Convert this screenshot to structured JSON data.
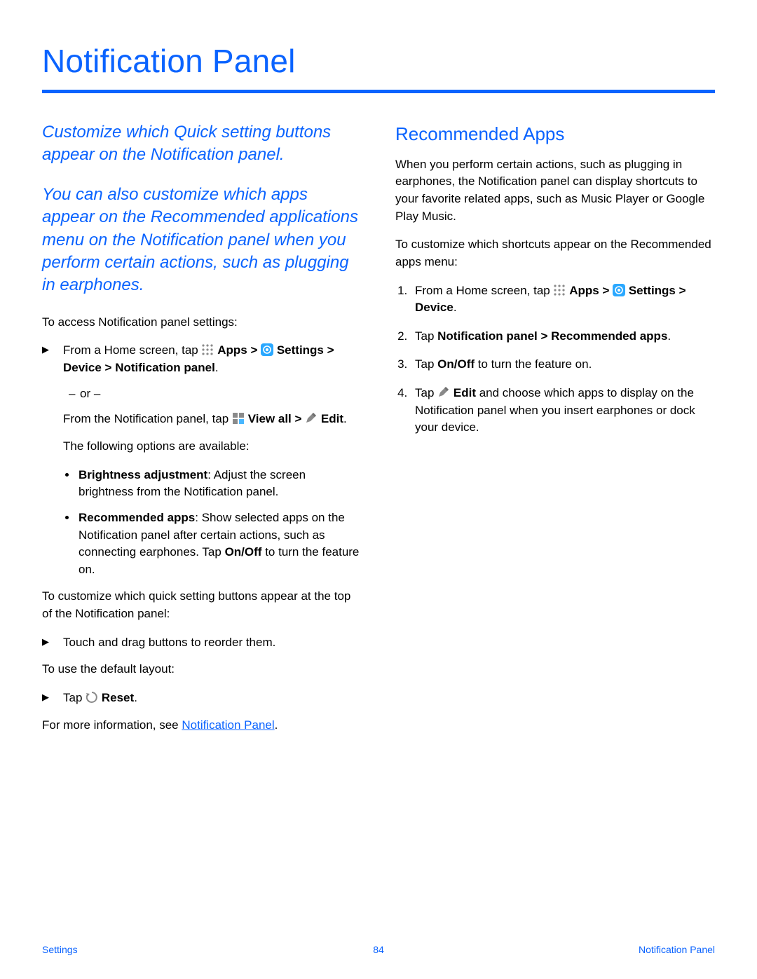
{
  "title": "Notification Panel",
  "left": {
    "intro1": "Customize which Quick setting buttons appear on the Notification panel.",
    "intro2": "You can also customize which apps appear on the Recommended applications menu on the Notification panel when you perform certain actions, such as plugging in earphones.",
    "access_lead": "To access Notification panel settings:",
    "access_step_prefix": "From a Home screen, tap ",
    "apps_label": "Apps",
    "gt1": " > ",
    "settings_label": "Settings",
    "path_tail": " > Device > Notification panel",
    "or_label": "or –",
    "alt_prefix": "From the Notification panel, tap ",
    "viewall_label": "View all",
    "edit_label": "Edit",
    "options_lead": "The following options are available:",
    "opt1_b": "Brightness adjustment",
    "opt1_rest": ": Adjust the screen brightness from the Notification panel.",
    "opt2_b": "Recommended apps",
    "opt2_rest": ": Show selected apps on the Notification panel after certain actions, such as connecting earphones. Tap ",
    "onoff": "On/Off",
    "opt2_tail": " to turn the feature on.",
    "customize_lead": "To customize which quick setting buttons appear at the top of the Notification panel:",
    "reorder": "Touch and drag buttons to reorder them.",
    "default_lead": "To use the default layout:",
    "tap_word": "Tap ",
    "reset_label": "Reset",
    "more_info_prefix": "For more information, see ",
    "more_info_link": "Notification Panel",
    "period": "."
  },
  "right": {
    "heading": "Recommended Apps",
    "p1": "When you perform certain actions, such as plugging in earphones, the Notification panel can display shortcuts to your favorite related apps, such as Music Player or Google Play Music.",
    "p2": "To customize which shortcuts appear on the Recommended apps menu:",
    "s1_prefix": "From a Home screen, tap ",
    "s1_apps": "Apps",
    "s1_gt": " > ",
    "s1_settings": "Settings",
    "s1_tail": " > Device",
    "s2_prefix": "Tap ",
    "s2_bold": "Notification panel > Recommended apps",
    "s3_prefix": "Tap ",
    "s3_bold": "On/Off",
    "s3_tail": " to turn the feature on.",
    "s4_prefix": "Tap ",
    "s4_bold": "Edit",
    "s4_tail": " and choose which apps to display on the Notification panel when you insert earphones or dock your device."
  },
  "footer": {
    "left": "Settings",
    "center": "84",
    "right": "Notification Panel"
  }
}
